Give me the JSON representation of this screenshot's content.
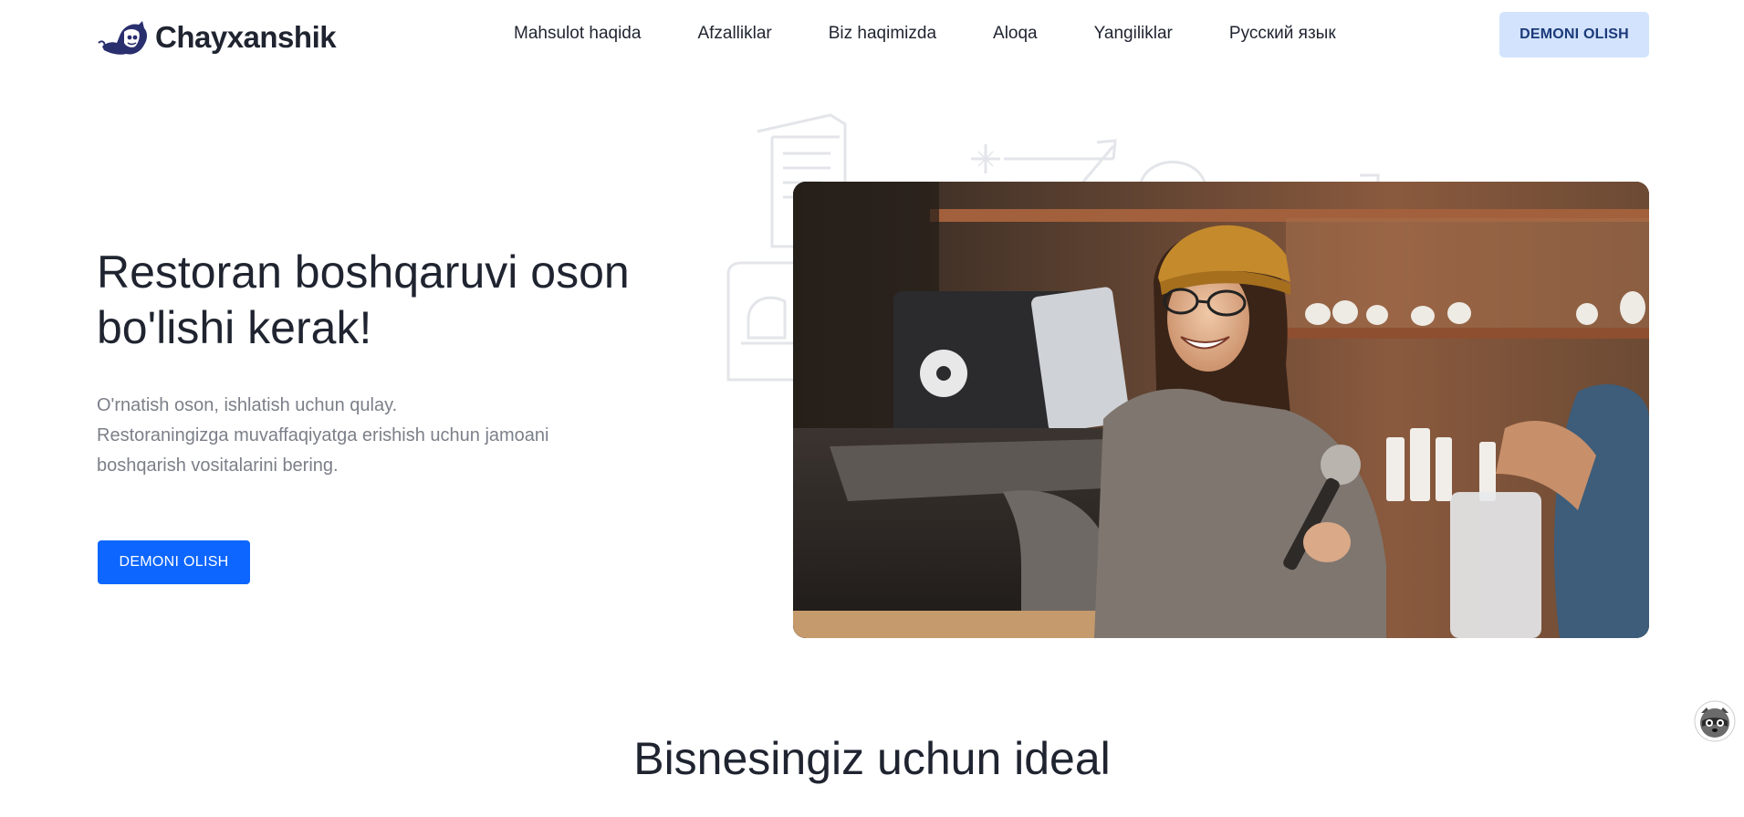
{
  "header": {
    "logo_text": "Chayxanshik",
    "nav": [
      {
        "label": "Mahsulot haqida"
      },
      {
        "label": "Afzalliklar"
      },
      {
        "label": "Biz haqimizda"
      },
      {
        "label": "Aloqa"
      },
      {
        "label": "Yangiliklar"
      },
      {
        "label": "Русский язык"
      }
    ],
    "cta_label": "DEMONI OLISH"
  },
  "hero": {
    "title": "Restoran boshqaruvi oson bo'lishi kerak!",
    "subtitle_lines": [
      "O'rnatish oson, ishlatish uchun qulay.",
      "Restoraningizga muvaffaqiyatga erishish uchun jamoani",
      "boshqarish vositalarini bering."
    ],
    "cta_label": "DEMONI OLISH"
  },
  "section": {
    "title": "Bisnesingiz uchun ideal"
  },
  "icons": {
    "logo": "raccoon-logo-icon",
    "chat": "raccoon-chat-icon"
  },
  "colors": {
    "primary": "#0d66ff",
    "primary_light": "#d3e3fd",
    "text_dark": "#1f2430",
    "text_muted": "#7b7f88"
  }
}
